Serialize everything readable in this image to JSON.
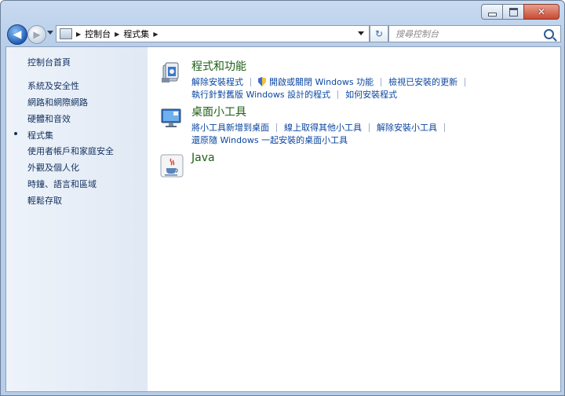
{
  "address_bar": {
    "crumbs": [
      "控制台",
      "程式集"
    ]
  },
  "search": {
    "placeholder": "搜尋控制台"
  },
  "sidebar": {
    "items": [
      {
        "label": "控制台首頁"
      },
      {
        "label": "系統及安全性"
      },
      {
        "label": "網路和網際網路"
      },
      {
        "label": "硬體和音效"
      },
      {
        "label": "程式集",
        "current": true
      },
      {
        "label": "使用者帳戶和家庭安全"
      },
      {
        "label": "外觀及個人化"
      },
      {
        "label": "時鐘、語言和區域"
      },
      {
        "label": "輕鬆存取"
      }
    ]
  },
  "sections": [
    {
      "title": "程式和功能",
      "icon": "programs-features-icon",
      "rows": [
        [
          "解除安裝程式",
          "開啟或關閉 Windows 功能",
          "檢視已安裝的更新"
        ],
        [
          "執行針對舊版 Windows 設計的程式",
          "如何安裝程式"
        ]
      ]
    },
    {
      "title": "桌面小工具",
      "icon": "desktop-gadgets-icon",
      "rows": [
        [
          "將小工具新增到桌面",
          "線上取得其他小工具",
          "解除安裝小工具"
        ],
        [
          "還原隨 Windows 一起安裝的桌面小工具"
        ]
      ]
    },
    {
      "title": "Java",
      "icon": "java-icon",
      "rows": []
    }
  ],
  "colors": {
    "link": "#0b47a1",
    "section_title": "#1e5f16",
    "sidebar_text": "#13305f"
  }
}
